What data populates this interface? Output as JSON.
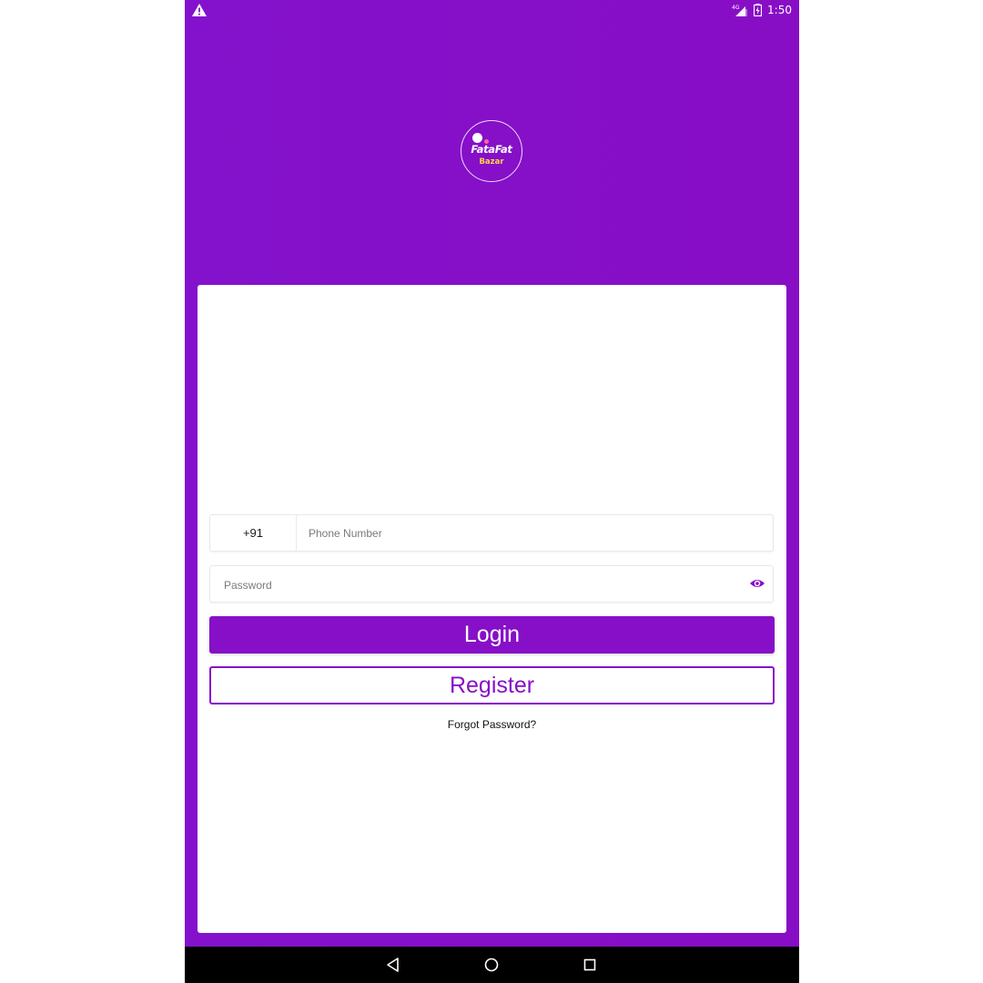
{
  "status_bar": {
    "time": "1:50",
    "network": "4G",
    "icons": [
      "warning-icon",
      "signal-icon",
      "battery-charging-icon"
    ]
  },
  "logo": {
    "title": "FataFat",
    "subtitle": "Bazar"
  },
  "form": {
    "country_code": "+91",
    "phone_placeholder": "Phone Number",
    "password_placeholder": "Password",
    "login_label": "Login",
    "register_label": "Register",
    "forgot_label": "Forgot Password?"
  },
  "nav_bar": {
    "buttons": [
      "back-icon",
      "home-icon",
      "recents-icon"
    ]
  },
  "colors": {
    "brand_purple": "#870fc8",
    "logo_accent": "#ffd34a",
    "dot_accent": "#ff5fa8"
  }
}
